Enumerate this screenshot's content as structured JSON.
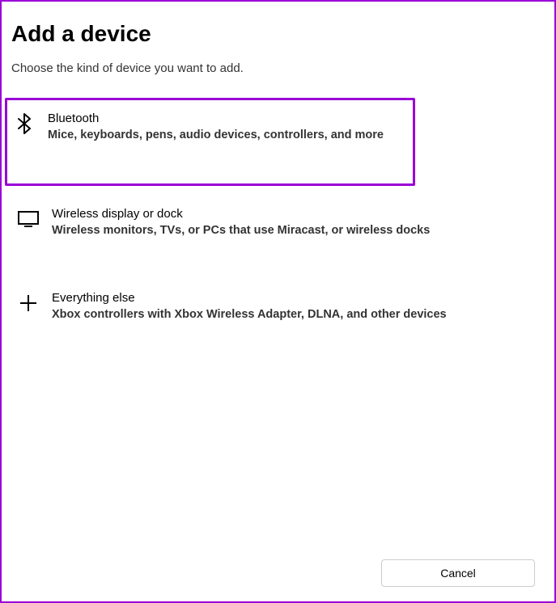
{
  "dialog": {
    "title": "Add a device",
    "subtitle": "Choose the kind of device you want to add."
  },
  "options": [
    {
      "icon": "bluetooth-icon",
      "title": "Bluetooth",
      "description": "Mice, keyboards, pens, audio devices, controllers, and more",
      "highlighted": true
    },
    {
      "icon": "monitor-icon",
      "title": "Wireless display or dock",
      "description": "Wireless monitors, TVs, or PCs that use Miracast, or wireless docks",
      "highlighted": false
    },
    {
      "icon": "plus-icon",
      "title": "Everything else",
      "description": "Xbox controllers with Xbox Wireless Adapter, DLNA, and other devices",
      "highlighted": false
    }
  ],
  "buttons": {
    "cancel": "Cancel"
  }
}
